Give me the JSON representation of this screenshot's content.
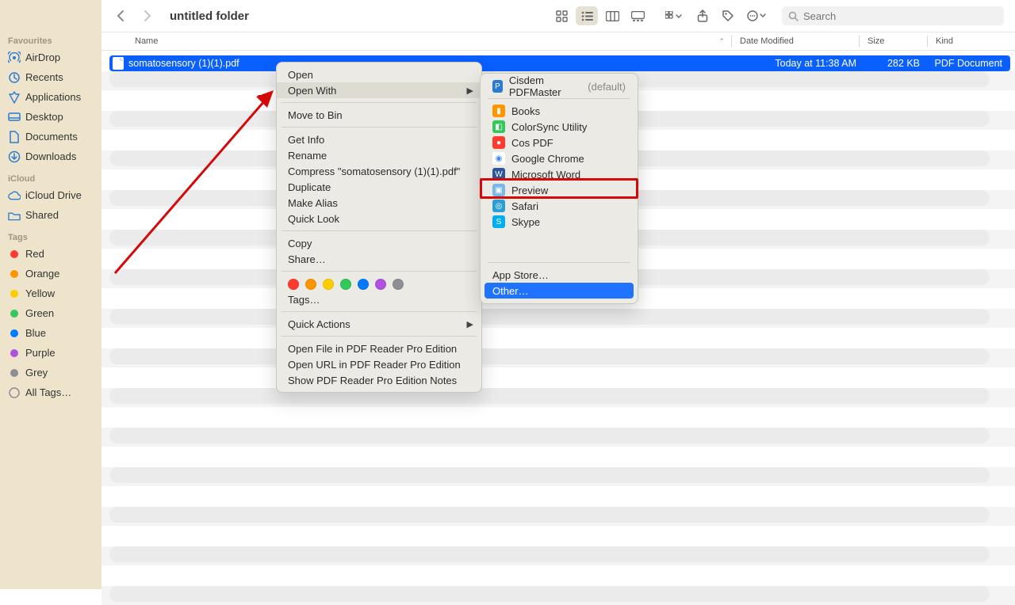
{
  "window_title": "untitled folder",
  "search_placeholder": "Search",
  "sidebar": {
    "sections": [
      {
        "title": "Favourites",
        "items": [
          {
            "label": "AirDrop",
            "icon": "airdrop-icon"
          },
          {
            "label": "Recents",
            "icon": "clock-icon"
          },
          {
            "label": "Applications",
            "icon": "apps-icon"
          },
          {
            "label": "Desktop",
            "icon": "desktop-icon"
          },
          {
            "label": "Documents",
            "icon": "document-icon"
          },
          {
            "label": "Downloads",
            "icon": "downloads-icon"
          }
        ]
      },
      {
        "title": "iCloud",
        "items": [
          {
            "label": "iCloud Drive",
            "icon": "cloud-icon"
          },
          {
            "label": "Shared",
            "icon": "shared-icon"
          }
        ]
      },
      {
        "title": "Tags",
        "items": [
          {
            "label": "Red",
            "color": "#ff3b30"
          },
          {
            "label": "Orange",
            "color": "#ff9500"
          },
          {
            "label": "Yellow",
            "color": "#ffcc00"
          },
          {
            "label": "Green",
            "color": "#34c759"
          },
          {
            "label": "Blue",
            "color": "#007aff"
          },
          {
            "label": "Purple",
            "color": "#af52de"
          },
          {
            "label": "Grey",
            "color": "#8e8e93"
          },
          {
            "label": "All Tags…",
            "icon": "alltags-icon"
          }
        ]
      }
    ]
  },
  "columns": {
    "name": "Name",
    "date": "Date Modified",
    "size": "Size",
    "kind": "Kind"
  },
  "file": {
    "name": "somatosensory (1)(1).pdf",
    "date": "Today at 11:38 AM",
    "size": "282 KB",
    "kind": "PDF Document"
  },
  "context_menu": {
    "items": [
      {
        "label": "Open"
      },
      {
        "label": "Open With",
        "hl": true,
        "submenu": true
      },
      {
        "sep": true
      },
      {
        "label": "Move to Bin"
      },
      {
        "sep": true
      },
      {
        "label": "Get Info"
      },
      {
        "label": "Rename"
      },
      {
        "label": "Compress \"somatosensory (1)(1).pdf\""
      },
      {
        "label": "Duplicate"
      },
      {
        "label": "Make Alias"
      },
      {
        "label": "Quick Look"
      },
      {
        "sep": true
      },
      {
        "label": "Copy"
      },
      {
        "label": "Share…"
      },
      {
        "sep": true
      },
      {
        "tags": true,
        "colors": [
          "#ff3b30",
          "#ff9500",
          "#ffcc00",
          "#34c759",
          "#007aff",
          "#af52de",
          "#8e8e93"
        ]
      },
      {
        "label": "Tags…"
      },
      {
        "sep": true
      },
      {
        "label": "Quick Actions",
        "submenu": true
      },
      {
        "sep": true
      },
      {
        "label": "Open File in PDF Reader Pro Edition"
      },
      {
        "label": "Open URL in PDF Reader Pro Edition"
      },
      {
        "label": "Show PDF Reader Pro Edition Notes"
      }
    ]
  },
  "submenu": {
    "default_app": {
      "label": "Cisdem PDFMaster",
      "suffix": "(default)",
      "bg": "#2a7bd4",
      "glyph": "P"
    },
    "apps": [
      {
        "label": "Books",
        "bg": "#ff9500",
        "glyph": "▮"
      },
      {
        "label": "ColorSync Utility",
        "bg": "#34c759",
        "glyph": "◧"
      },
      {
        "label": "Cos PDF",
        "bg": "#ff3b30",
        "glyph": "●"
      },
      {
        "label": "Google Chrome",
        "bg": "#ffffff",
        "glyph": "◉",
        "fg": "#4285f4"
      },
      {
        "label": "Microsoft Word",
        "bg": "#2b579a",
        "glyph": "W"
      },
      {
        "label": "Preview",
        "bg": "#7bb7e6",
        "glyph": "▣",
        "highlight": true
      },
      {
        "label": "Safari",
        "bg": "#2a9fd6",
        "glyph": "◎"
      },
      {
        "label": "Skype",
        "bg": "#00aff0",
        "glyph": "S"
      }
    ],
    "footer": [
      {
        "label": "App Store…"
      },
      {
        "label": "Other…",
        "selected": true
      }
    ]
  }
}
